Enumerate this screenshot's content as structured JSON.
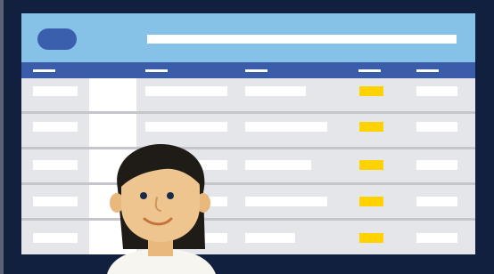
{
  "colors": {
    "frame": "#122040",
    "topbar": "#86c2e8",
    "accent": "#3a5fad",
    "header": "#3b5ca8",
    "highlight": "#ffd200",
    "row": "#e4e6ea"
  },
  "table": {
    "row_count": 5,
    "highlighted_column": 4
  },
  "illustration": {
    "subject": "person-avatar"
  }
}
